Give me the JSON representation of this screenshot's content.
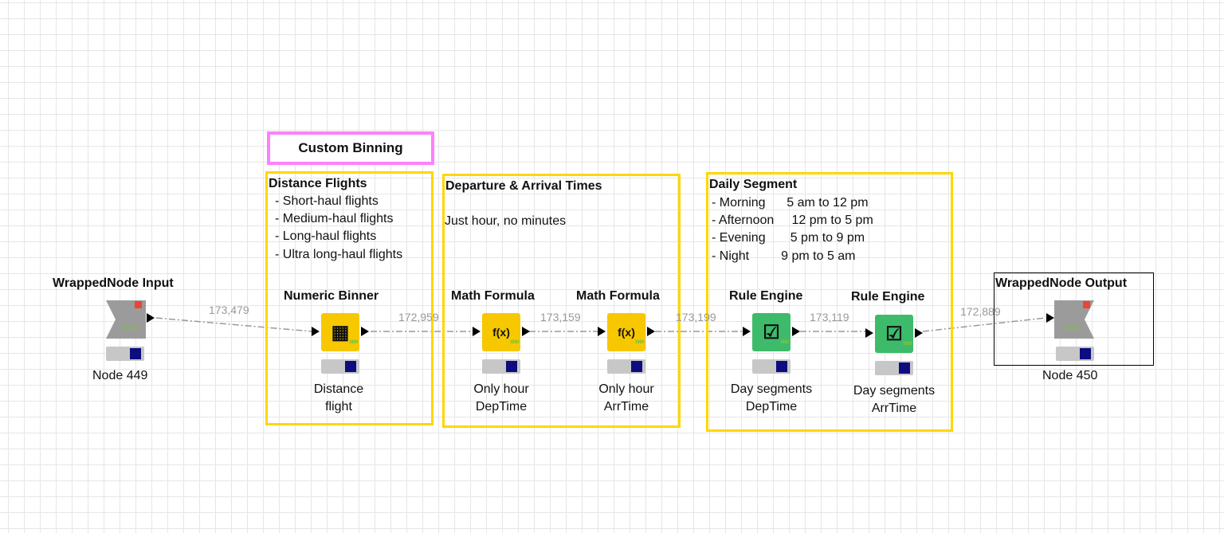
{
  "annotations": {
    "custom_binning": "Custom Binning",
    "distance": {
      "title": "Distance Flights",
      "lines": [
        "- Short-haul flights",
        "- Medium-haul flights",
        "- Long-haul flights",
        "- Ultra long-haul flights"
      ]
    },
    "times": {
      "title": "Departure & Arrival Times",
      "line": "Just hour, no minutes"
    },
    "daily": {
      "title": "Daily Segment",
      "lines": [
        "- Morning      5 am to 12 pm",
        "- Afternoon     12 pm to 5 pm",
        "- Evening       5 pm to 9 pm",
        "- Night         9 pm to 5 am"
      ]
    }
  },
  "nodes": {
    "input": {
      "title": "WrappedNode Input",
      "label": "Node 449"
    },
    "binner": {
      "title": "Numeric Binner",
      "label1": "Distance",
      "label2": "flight",
      "glyph": "▦"
    },
    "math1": {
      "title": "Math Formula",
      "label1": "Only hour",
      "label2": "DepTime",
      "glyph": "f(x)"
    },
    "math2": {
      "title": "Math Formula",
      "label1": "Only hour",
      "label2": "ArrTime",
      "glyph": "f(x)"
    },
    "rule1": {
      "title": "Rule Engine",
      "label1": "Day segments",
      "label2": "DepTime",
      "glyph": "☑"
    },
    "rule2": {
      "title": "Rule Engine",
      "label1": "Day segments",
      "label2": "ArrTime",
      "glyph": "☑"
    },
    "output": {
      "title": "WrappedNode Output",
      "label": "Node 450"
    }
  },
  "connections": [
    "173,479",
    "172,959",
    "173,159",
    "173,199",
    "173,119",
    "172,889"
  ],
  "icons": {
    "chevron": "»»»",
    "lock": "lock-icon"
  },
  "colors": {
    "annotation_yellow": "#ffd600",
    "annotation_pink": "#ff80ff",
    "node_yellow": "#f7c800",
    "node_green": "#3dbb6b",
    "status_blue": "#0d0d80"
  }
}
